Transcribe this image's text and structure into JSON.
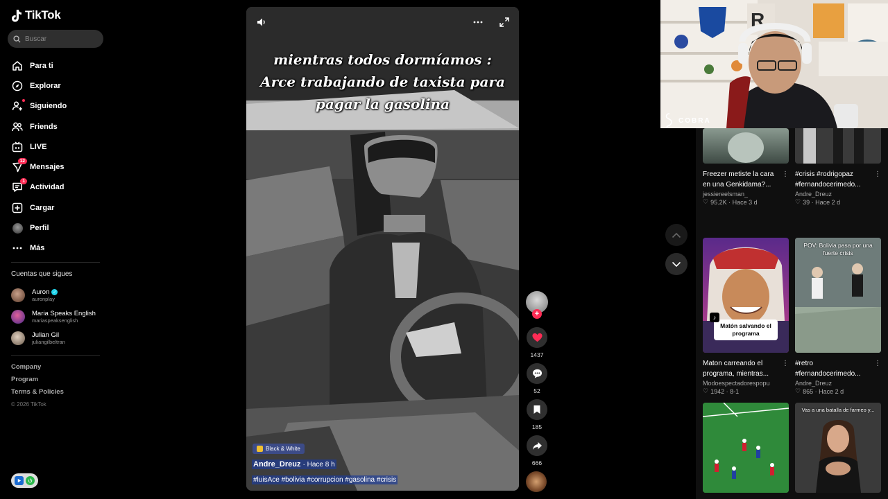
{
  "app": {
    "name": "TikTok"
  },
  "search": {
    "placeholder": "Buscar"
  },
  "nav": [
    {
      "label": "Para ti",
      "icon": "home-icon"
    },
    {
      "label": "Explorar",
      "icon": "compass-icon"
    },
    {
      "label": "Siguiendo",
      "icon": "following-icon"
    },
    {
      "label": "Friends",
      "icon": "friends-icon"
    },
    {
      "label": "LIVE",
      "icon": "live-icon"
    },
    {
      "label": "Mensajes",
      "icon": "messages-icon",
      "badge": "12"
    },
    {
      "label": "Actividad",
      "icon": "activity-icon",
      "badge": "1"
    },
    {
      "label": "Cargar",
      "icon": "upload-icon"
    },
    {
      "label": "Perfil",
      "icon": "profile-icon"
    },
    {
      "label": "Más",
      "icon": "more-icon"
    }
  ],
  "following": {
    "title": "Cuentas que sigues",
    "accounts": [
      {
        "name": "Auron",
        "handle": "auronplay",
        "verified": true,
        "color": "#6a4a3a"
      },
      {
        "name": "Maria Speaks English",
        "handle": "mariaspeaksenglish",
        "verified": false,
        "color": "#7a3a8a"
      },
      {
        "name": "Julian Gil",
        "handle": "juliangilbeltran",
        "verified": false,
        "color": "#8a7a6a"
      }
    ]
  },
  "footer": {
    "links": [
      "Company",
      "Program",
      "Terms & Policies"
    ],
    "copyright": "© 2026 TikTok"
  },
  "video": {
    "caption_lines": [
      "mientras todos dormíamos :",
      "Arce trabajando de taxista para",
      "pagar la gasolina"
    ],
    "effect_tag": "Black & White",
    "author": "Andre_Dreuz",
    "time": "· Hace 8 h",
    "hashtags": "#luisAce #bolivia #corrupcion #gasolina #crisis"
  },
  "actions": {
    "likes": "1437",
    "comments": "52",
    "saves": "185",
    "shares": "666"
  },
  "recommended": [
    {
      "title": "Freezer metiste la cara en una Genkidama?...",
      "author": "jessiereelsman_",
      "meta": "95.2K · Hace 3 d",
      "thumb_text": ""
    },
    {
      "title": "#crisis #rodrigopaz #fernandocerimedo...",
      "author": "Andre_Dreuz",
      "meta": "39 · Hace 2 d",
      "thumb_text": ""
    },
    {
      "title": "Maton carreando el programa, mientras...",
      "author": "Modoespectadorespopu",
      "meta": "1942 · 8-1",
      "thumb_text": "Matón salvando el programa"
    },
    {
      "title": "#retro #fernandocerimedo...",
      "author": "Andre_Dreuz",
      "meta": "865 · Hace 2 d",
      "thumb_text": "POV: Bolivia pasa por una fuerte crisis"
    },
    {
      "title": "",
      "author": "",
      "meta": "",
      "thumb_text": ""
    },
    {
      "title": "",
      "author": "",
      "meta": "",
      "thumb_text": "Vas a una batalla de farmeo y..."
    }
  ],
  "webcam": {
    "label": "COBRA"
  },
  "colors": {
    "accent": "#fe2c55",
    "background": "#000000",
    "panel": "#0f0f0f"
  }
}
